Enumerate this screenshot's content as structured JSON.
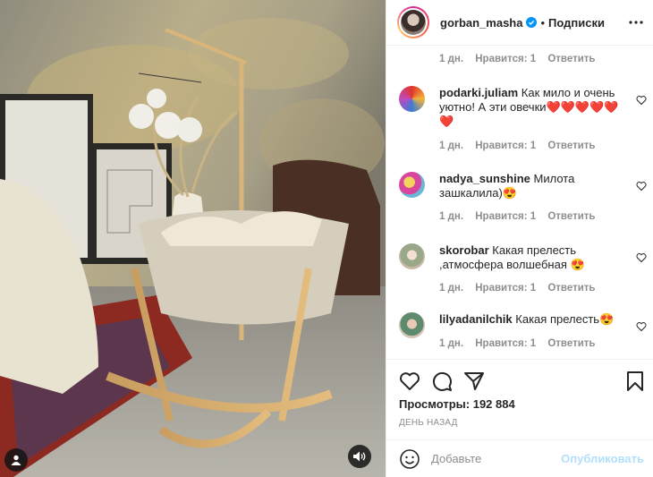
{
  "owner": {
    "username": "gorban_masha",
    "verified_icon": "verified-badge-icon",
    "separator": "•",
    "follow_label": "Подписки",
    "more_icon": "more-horizontal-icon"
  },
  "first_meta": {
    "time": "1 дн.",
    "likes": "Нравится: 1",
    "reply": "Ответить"
  },
  "comments": [
    {
      "username": "podarki.juliam",
      "text": "Как мило и очень уютно! А эти овечки",
      "emoji": "❤️❤️❤️❤️❤️❤️",
      "time": "1 дн.",
      "likes": "Нравится: 1",
      "reply": "Ответить"
    },
    {
      "username": "nadya_sunshine",
      "text": "Милота зашкалила)",
      "emoji": "😍",
      "time": "1 дн.",
      "likes": "Нравится: 1",
      "reply": "Ответить"
    },
    {
      "username": "skorobar",
      "text": "Какая прелесть ,атмосфера волшебная",
      "emoji": "😍",
      "time": "1 дн.",
      "likes": "Нравится: 1",
      "reply": "Ответить"
    },
    {
      "username": "lilyadanilchik",
      "text": "Какая прелесть",
      "emoji": "😍",
      "time": "1 дн.",
      "likes": "Нравится: 1",
      "reply": "Ответить"
    }
  ],
  "stats": {
    "views_label": "Просмотры:",
    "views_value": "192 884",
    "date": "ДЕНЬ НАЗАД"
  },
  "composer": {
    "placeholder": "Добавьте",
    "publish_label": "Опубликовать"
  },
  "colors": {
    "accent": "#0095f6",
    "publish_disabled": "#b2dffc",
    "heart": "#ed1c24"
  }
}
